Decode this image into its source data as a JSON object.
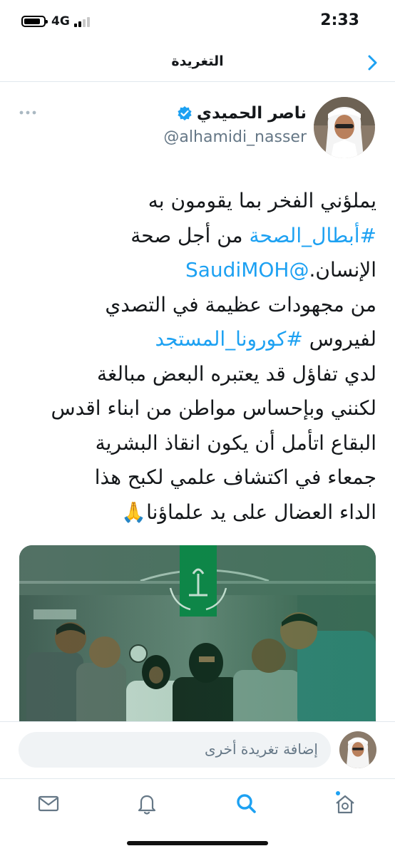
{
  "status_bar": {
    "time": "2:33",
    "network": "4G",
    "battery_level": 0.85
  },
  "header": {
    "title": "التغريدة"
  },
  "tweet": {
    "author": {
      "name": "ناصر الحميدي",
      "handle": "@alhamidi_nasser",
      "verified": true
    },
    "lines": [
      {
        "parts": [
          {
            "text": "يملؤني الفخر بما يقومون به"
          }
        ]
      },
      {
        "parts": [
          {
            "text": "#أبطال_الصحة",
            "link": true
          },
          {
            "text": " من أجل صحة"
          }
        ]
      },
      {
        "parts": [
          {
            "text": "الإنسان."
          },
          {
            "text": "@SaudiMOH",
            "link": true
          }
        ]
      },
      {
        "parts": [
          {
            "text": "من مجهودات عظيمة في التصدي"
          }
        ]
      },
      {
        "parts": [
          {
            "text": "لفيروس "
          },
          {
            "text": "#كورونا_المستجد",
            "link": true
          }
        ]
      },
      {
        "parts": [
          {
            "text": "لدي تفاؤل قد يعتبره البعض مبالغة"
          }
        ]
      },
      {
        "parts": [
          {
            "text": "لكنني وبإحساس مواطن من ابناء اقدس"
          }
        ]
      },
      {
        "parts": [
          {
            "text": "البقاع اتأمل أن يكون انقاذ البشرية"
          }
        ]
      },
      {
        "parts": [
          {
            "text": "جمعاء في اكتشاف علمي لكبح هذا"
          }
        ]
      },
      {
        "parts": [
          {
            "text": "الداء العضال على يد علماؤنا🙏"
          }
        ]
      }
    ]
  },
  "compose": {
    "placeholder": "إضافة تغريدة أخرى"
  },
  "tab_bar": {
    "items": [
      "home-icon",
      "search-icon",
      "notifications-icon",
      "messages-icon"
    ]
  },
  "colors": {
    "accent": "#1da1f2",
    "text": "#14171a",
    "secondary": "#657786",
    "media_green": "#0f8a4a"
  }
}
